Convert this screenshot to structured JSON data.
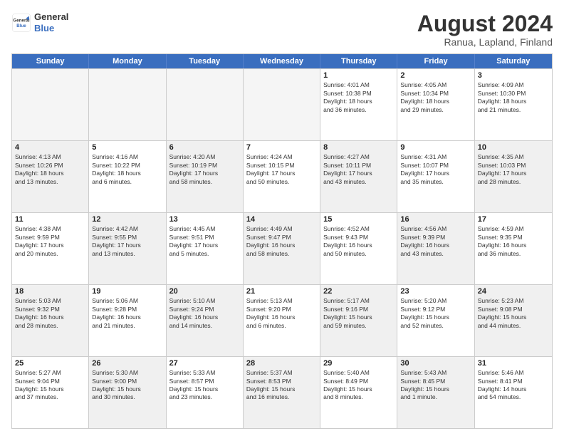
{
  "logo": {
    "line1": "General",
    "line2": "Blue"
  },
  "title": "August 2024",
  "subtitle": "Ranua, Lapland, Finland",
  "header_days": [
    "Sunday",
    "Monday",
    "Tuesday",
    "Wednesday",
    "Thursday",
    "Friday",
    "Saturday"
  ],
  "rows": [
    [
      {
        "day": "",
        "info": "",
        "empty": true
      },
      {
        "day": "",
        "info": "",
        "empty": true
      },
      {
        "day": "",
        "info": "",
        "empty": true
      },
      {
        "day": "",
        "info": "",
        "empty": true
      },
      {
        "day": "1",
        "info": "Sunrise: 4:01 AM\nSunset: 10:38 PM\nDaylight: 18 hours\nand 36 minutes."
      },
      {
        "day": "2",
        "info": "Sunrise: 4:05 AM\nSunset: 10:34 PM\nDaylight: 18 hours\nand 29 minutes."
      },
      {
        "day": "3",
        "info": "Sunrise: 4:09 AM\nSunset: 10:30 PM\nDaylight: 18 hours\nand 21 minutes."
      }
    ],
    [
      {
        "day": "4",
        "info": "Sunrise: 4:13 AM\nSunset: 10:26 PM\nDaylight: 18 hours\nand 13 minutes.",
        "shaded": true
      },
      {
        "day": "5",
        "info": "Sunrise: 4:16 AM\nSunset: 10:22 PM\nDaylight: 18 hours\nand 6 minutes."
      },
      {
        "day": "6",
        "info": "Sunrise: 4:20 AM\nSunset: 10:19 PM\nDaylight: 17 hours\nand 58 minutes.",
        "shaded": true
      },
      {
        "day": "7",
        "info": "Sunrise: 4:24 AM\nSunset: 10:15 PM\nDaylight: 17 hours\nand 50 minutes."
      },
      {
        "day": "8",
        "info": "Sunrise: 4:27 AM\nSunset: 10:11 PM\nDaylight: 17 hours\nand 43 minutes.",
        "shaded": true
      },
      {
        "day": "9",
        "info": "Sunrise: 4:31 AM\nSunset: 10:07 PM\nDaylight: 17 hours\nand 35 minutes."
      },
      {
        "day": "10",
        "info": "Sunrise: 4:35 AM\nSunset: 10:03 PM\nDaylight: 17 hours\nand 28 minutes.",
        "shaded": true
      }
    ],
    [
      {
        "day": "11",
        "info": "Sunrise: 4:38 AM\nSunset: 9:59 PM\nDaylight: 17 hours\nand 20 minutes."
      },
      {
        "day": "12",
        "info": "Sunrise: 4:42 AM\nSunset: 9:55 PM\nDaylight: 17 hours\nand 13 minutes.",
        "shaded": true
      },
      {
        "day": "13",
        "info": "Sunrise: 4:45 AM\nSunset: 9:51 PM\nDaylight: 17 hours\nand 5 minutes."
      },
      {
        "day": "14",
        "info": "Sunrise: 4:49 AM\nSunset: 9:47 PM\nDaylight: 16 hours\nand 58 minutes.",
        "shaded": true
      },
      {
        "day": "15",
        "info": "Sunrise: 4:52 AM\nSunset: 9:43 PM\nDaylight: 16 hours\nand 50 minutes."
      },
      {
        "day": "16",
        "info": "Sunrise: 4:56 AM\nSunset: 9:39 PM\nDaylight: 16 hours\nand 43 minutes.",
        "shaded": true
      },
      {
        "day": "17",
        "info": "Sunrise: 4:59 AM\nSunset: 9:35 PM\nDaylight: 16 hours\nand 36 minutes."
      }
    ],
    [
      {
        "day": "18",
        "info": "Sunrise: 5:03 AM\nSunset: 9:32 PM\nDaylight: 16 hours\nand 28 minutes.",
        "shaded": true
      },
      {
        "day": "19",
        "info": "Sunrise: 5:06 AM\nSunset: 9:28 PM\nDaylight: 16 hours\nand 21 minutes."
      },
      {
        "day": "20",
        "info": "Sunrise: 5:10 AM\nSunset: 9:24 PM\nDaylight: 16 hours\nand 14 minutes.",
        "shaded": true
      },
      {
        "day": "21",
        "info": "Sunrise: 5:13 AM\nSunset: 9:20 PM\nDaylight: 16 hours\nand 6 minutes."
      },
      {
        "day": "22",
        "info": "Sunrise: 5:17 AM\nSunset: 9:16 PM\nDaylight: 15 hours\nand 59 minutes.",
        "shaded": true
      },
      {
        "day": "23",
        "info": "Sunrise: 5:20 AM\nSunset: 9:12 PM\nDaylight: 15 hours\nand 52 minutes."
      },
      {
        "day": "24",
        "info": "Sunrise: 5:23 AM\nSunset: 9:08 PM\nDaylight: 15 hours\nand 44 minutes.",
        "shaded": true
      }
    ],
    [
      {
        "day": "25",
        "info": "Sunrise: 5:27 AM\nSunset: 9:04 PM\nDaylight: 15 hours\nand 37 minutes."
      },
      {
        "day": "26",
        "info": "Sunrise: 5:30 AM\nSunset: 9:00 PM\nDaylight: 15 hours\nand 30 minutes.",
        "shaded": true
      },
      {
        "day": "27",
        "info": "Sunrise: 5:33 AM\nSunset: 8:57 PM\nDaylight: 15 hours\nand 23 minutes."
      },
      {
        "day": "28",
        "info": "Sunrise: 5:37 AM\nSunset: 8:53 PM\nDaylight: 15 hours\nand 16 minutes.",
        "shaded": true
      },
      {
        "day": "29",
        "info": "Sunrise: 5:40 AM\nSunset: 8:49 PM\nDaylight: 15 hours\nand 8 minutes."
      },
      {
        "day": "30",
        "info": "Sunrise: 5:43 AM\nSunset: 8:45 PM\nDaylight: 15 hours\nand 1 minute.",
        "shaded": true
      },
      {
        "day": "31",
        "info": "Sunrise: 5:46 AM\nSunset: 8:41 PM\nDaylight: 14 hours\nand 54 minutes."
      }
    ]
  ]
}
